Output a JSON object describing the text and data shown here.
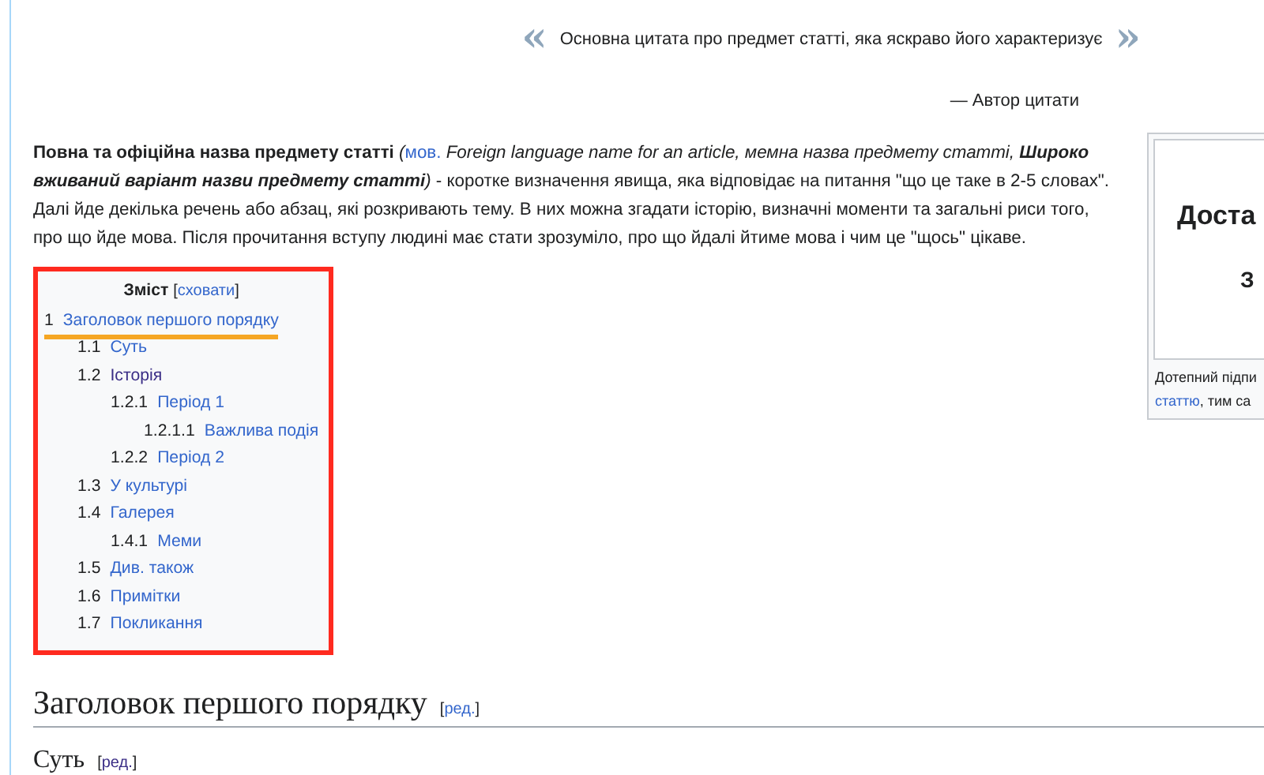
{
  "quote": {
    "open_mark": "«",
    "text": "Основна цитата про предмет статті, яка яскраво його характеризує",
    "close_mark": "»",
    "author": "— Автор цитати"
  },
  "intro": {
    "lead": "**Повна та офіційна назва предмету статті** *(*",
    "link": "мов.",
    "rest_italic": "Foreign language name for an article, мемна назва предмету статті, **Широко вживаний варіант назви предмету статті**)",
    "rest": "- коротке визначення явища, яка відповідає на питання \"що це таке в 2-5 словах\". Далі йде декілька речень або абзац, які розкривають тему. В них можна згадати історію, визначні моменти та загальні риси того, про що йде мова. Після прочитання вступу людині має стати зрозуміло, про що йдалі йтиме мова і чим це \"щось\" цікаве."
  },
  "infobox": {
    "title": "Доста",
    "subtitle": "З",
    "caption": "Дотепний підпи",
    "caption_link": "статтю",
    "caption_rest": ", тим са"
  },
  "toc": {
    "title": "Зміст",
    "toggle_open": "[",
    "toggle": "сховати",
    "toggle_close": "]",
    "highlighted_frame": true,
    "items": [
      {
        "number": "1",
        "label": "Заголовок першого порядку",
        "visited": false,
        "highlighted": true,
        "children": [
          {
            "number": "1.1",
            "label": "Суть",
            "visited": false,
            "highlighted": false
          },
          {
            "number": "1.2",
            "label": "Історія",
            "visited": true,
            "highlighted": false,
            "children": [
              {
                "number": "1.2.1",
                "label": "Період 1",
                "visited": false,
                "highlighted": false,
                "children": [
                  {
                    "number": "1.2.1.1",
                    "label": "Важлива подія",
                    "visited": false,
                    "highlighted": false
                  }
                ]
              },
              {
                "number": "1.2.2",
                "label": "Період 2",
                "visited": false,
                "highlighted": false
              }
            ]
          },
          {
            "number": "1.3",
            "label": "У культурі",
            "visited": false,
            "highlighted": false
          },
          {
            "number": "1.4",
            "label": "Галерея",
            "visited": false,
            "highlighted": false,
            "children": [
              {
                "number": "1.4.1",
                "label": "Меми",
                "visited": false,
                "highlighted": false
              }
            ]
          },
          {
            "number": "1.5",
            "label": "Див. також",
            "visited": false,
            "highlighted": false
          },
          {
            "number": "1.6",
            "label": "Примітки",
            "visited": false,
            "highlighted": false
          },
          {
            "number": "1.7",
            "label": "Покликання",
            "visited": false,
            "highlighted": false
          }
        ]
      }
    ]
  },
  "headings": [
    {
      "kind": "h2",
      "text": "Заголовок першого порядку",
      "edit_open": "[",
      "edit": "ред.",
      "edit_close": "]",
      "edit_visited": false
    },
    {
      "kind": "h3",
      "text": "Суть",
      "edit_open": "[",
      "edit": "ред.",
      "edit_close": "]",
      "edit_visited": true
    }
  ]
}
